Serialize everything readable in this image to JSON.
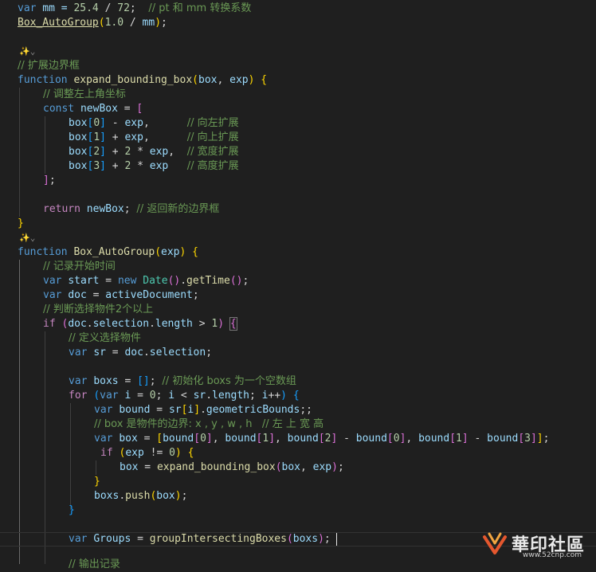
{
  "watermark": {
    "logo_text": "華印社區",
    "url": "www.52cnp.com"
  },
  "colors": {
    "background": "#1f1f1f",
    "keyword": "#569cd6",
    "function": "#dcdcaa",
    "variable": "#9cdcfe",
    "comment": "#6a9955",
    "number": "#b5cea8"
  },
  "code": {
    "l1": {
      "t1": "var",
      "t2": " mm = ",
      "t3": "25.4",
      "t4": " / ",
      "t5": "72",
      "t6": ";  ",
      "t7": "// pt 和 mm 转换系数"
    },
    "l2": {
      "t1": "Box_AutoGroup",
      "t2": "(",
      "t3": "1.0",
      "t4": " / ",
      "t5": "mm",
      "t6": ")",
      "t7": ";"
    },
    "l3": {
      "icon": "✨⌄"
    },
    "l4": {
      "t1": "// 扩展边界框"
    },
    "l5": {
      "t1": "function",
      "t2": " ",
      "t3": "expand_bounding_box",
      "t4": "(",
      "t5": "box",
      "t6": ", ",
      "t7": "exp",
      "t8": ")",
      "t9": " ",
      "t10": "{"
    },
    "l6": {
      "t1": "// 调整左上角坐标"
    },
    "l7": {
      "t1": "const",
      "t2": " ",
      "t3": "newBox",
      "t4": " = ",
      "t5": "["
    },
    "l8": {
      "t1": "box",
      "t2": "[",
      "t3": "0",
      "t4": "]",
      "t5": " - ",
      "t6": "exp",
      "t7": ",      ",
      "t8": "// 向左扩展"
    },
    "l9": {
      "t1": "box",
      "t2": "[",
      "t3": "1",
      "t4": "]",
      "t5": " + ",
      "t6": "exp",
      "t7": ",      ",
      "t8": "// 向上扩展"
    },
    "l10": {
      "t1": "box",
      "t2": "[",
      "t3": "2",
      "t4": "]",
      "t5": " + ",
      "t6": "2",
      "t7": " * ",
      "t8": "exp",
      "t9": ",  ",
      "t10": "// 宽度扩展"
    },
    "l11": {
      "t1": "box",
      "t2": "[",
      "t3": "3",
      "t4": "]",
      "t5": " + ",
      "t6": "2",
      "t7": " * ",
      "t8": "exp",
      "t9": "   ",
      "t10": "// 高度扩展"
    },
    "l12": {
      "t1": "]",
      "t2": ";"
    },
    "l14": {
      "t1": "return",
      "t2": " ",
      "t3": "newBox",
      "t4": "; ",
      "t5": "// 返回新的边界框"
    },
    "l15": {
      "t1": "}"
    },
    "l16": {
      "icon": "✨⌄"
    },
    "l17": {
      "t1": "function",
      "t2": " ",
      "t3": "Box_AutoGroup",
      "t4": "(",
      "t5": "exp",
      "t6": ")",
      "t7": " ",
      "t8": "{"
    },
    "l18": {
      "t1": "// 记录开始时间"
    },
    "l19": {
      "t1": "var",
      "t2": " ",
      "t3": "start",
      "t4": " = ",
      "t5": "new",
      "t6": " ",
      "t7": "Date",
      "t8": "()",
      "t9": ".",
      "t10": "getTime",
      "t11": "()",
      "t12": ";"
    },
    "l20": {
      "t1": "var",
      "t2": " ",
      "t3": "doc",
      "t4": " = ",
      "t5": "activeDocument",
      "t6": ";"
    },
    "l21": {
      "t1": "// 判断选择物件2个以上"
    },
    "l22": {
      "t1": "if",
      "t2": " (",
      "t3": "doc",
      "t4": ".",
      "t5": "selection",
      "t6": ".",
      "t7": "length",
      "t8": " > ",
      "t9": "1",
      "t10": ") ",
      "t11": "{"
    },
    "l23": {
      "t1": "// 定义选择物件"
    },
    "l24": {
      "t1": "var",
      "t2": " ",
      "t3": "sr",
      "t4": " = ",
      "t5": "doc",
      "t6": ".",
      "t7": "selection",
      "t8": ";"
    },
    "l26": {
      "t1": "var",
      "t2": " ",
      "t3": "boxs",
      "t4": " = ",
      "t5": "[]",
      "t6": "; ",
      "t7": "// 初始化 boxs 为一个空数组"
    },
    "l27": {
      "t1": "for",
      "t2": " ",
      "t3": "(",
      "t4": "var",
      "t5": " ",
      "t6": "i",
      "t7": " = ",
      "t8": "0",
      "t9": "; ",
      "t10": "i",
      "t11": " < ",
      "t12": "sr",
      "t13": ".",
      "t14": "length",
      "t15": "; ",
      "t16": "i",
      "t17": "++",
      "t18": ")",
      "t19": " ",
      "t20": "{"
    },
    "l28": {
      "t1": "var",
      "t2": " ",
      "t3": "bound",
      "t4": " = ",
      "t5": "sr",
      "t6": "[",
      "t7": "i",
      "t8": "]",
      "t9": ".",
      "t10": "geometricBounds",
      "t11": ";;"
    },
    "l29": {
      "t1": "// box 是物件的边界: x , y , w , h   // 左 上 宽 高"
    },
    "l30": {
      "t1": "var",
      "t2": " ",
      "t3": "box",
      "t4": " = ",
      "t5": "[",
      "t6": "bound",
      "t7": "[",
      "t8": "0",
      "t9": "]",
      "t10": ", ",
      "t11": "bound",
      "t12": "[",
      "t13": "1",
      "t14": "]",
      "t15": ", ",
      "t16": "bound",
      "t17": "[",
      "t18": "2",
      "t19": "]",
      "t20": " - ",
      "t21": "bound",
      "t22": "[",
      "t23": "0",
      "t24": "]",
      "t25": ", ",
      "t26": "bound",
      "t27": "[",
      "t28": "1",
      "t29": "]",
      "t30": " - ",
      "t31": "bound",
      "t32": "[",
      "t33": "3",
      "t34": "]",
      "t35": "]",
      "t36": ";"
    },
    "l31": {
      "t1": "if",
      "t2": " ",
      "t3": "(",
      "t4": "exp",
      "t5": " != ",
      "t6": "0",
      "t7": ")",
      "t8": " ",
      "t9": "{"
    },
    "l32": {
      "t1": "box",
      "t2": " = ",
      "t3": "expand_bounding_box",
      "t4": "(",
      "t5": "box",
      "t6": ", ",
      "t7": "exp",
      "t8": ")",
      "t9": ";"
    },
    "l33": {
      "t1": "}"
    },
    "l34": {
      "t1": "boxs",
      "t2": ".",
      "t3": "push",
      "t4": "(",
      "t5": "box",
      "t6": ")",
      "t7": ";"
    },
    "l35": {
      "t1": "}"
    },
    "l37": {
      "t1": "var",
      "t2": " ",
      "t3": "Groups",
      "t4": " = ",
      "t5": "groupIntersectingBoxes",
      "t6": "(",
      "t7": "boxs",
      "t8": ")",
      "t9": ";"
    },
    "l38": {
      "t1": "// 输出记录"
    }
  }
}
